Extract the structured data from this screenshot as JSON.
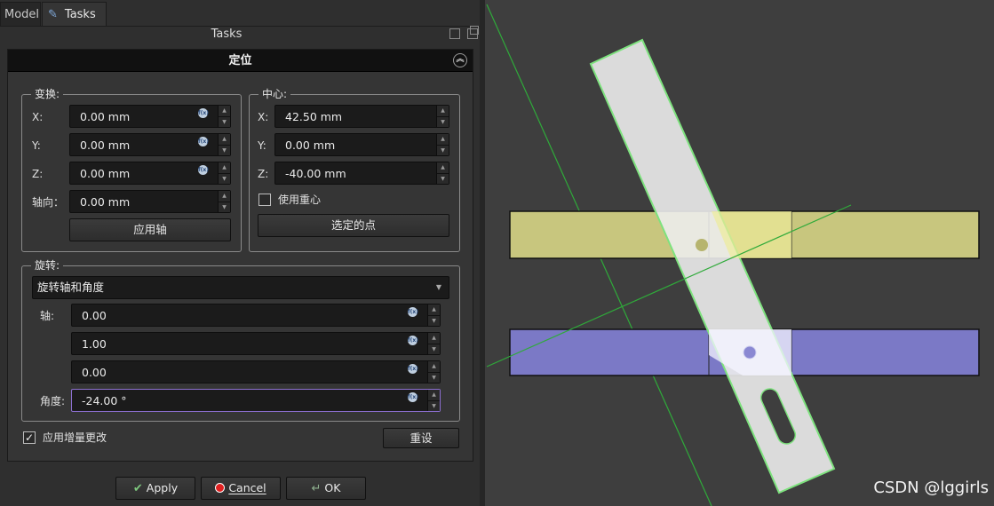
{
  "tabs": [
    {
      "label": "Model"
    },
    {
      "label": "Tasks"
    }
  ],
  "panel_title": "Tasks",
  "dialog": {
    "title": "定位",
    "translation": {
      "title": "变换:",
      "x_label": "X:",
      "x_value": "0.00 mm",
      "y_label": "Y:",
      "y_value": "0.00 mm",
      "z_label": "Z:",
      "z_value": "0.00 mm",
      "axial_label": "轴向：",
      "axial_value": "0.00 mm",
      "apply_axial_button": "应用轴"
    },
    "center": {
      "title": "中心:",
      "x_label": "X:",
      "x_value": "42.50 mm",
      "y_label": "Y:",
      "y_value": "0.00 mm",
      "z_label": "Z:",
      "z_value": "-40.00 mm",
      "use_center_of_mass_label": "使用重心",
      "use_center_of_mass_checked": false,
      "selected_points_button": "选定的点"
    },
    "rotation": {
      "title": "旋转:",
      "mode_selected": "旋转轴和角度",
      "axis_label": "轴:",
      "axis_x": "0.00",
      "axis_y": "1.00",
      "axis_z": "0.00",
      "angle_label": "角度:",
      "angle_value": "-24.00 °"
    },
    "apply_incremental_label": "应用增量更改",
    "apply_incremental_checked": true,
    "reset_button": "重设"
  },
  "buttons": {
    "apply": "Apply",
    "cancel": "Cancel",
    "ok": "OK"
  },
  "view": {
    "watermark": "CSDN @lggirls",
    "colors": {
      "background": "#3e3e3e",
      "yellow_bar": "#c8c67e",
      "blue_bar": "#7b79c6",
      "selected_part": "#ececec",
      "highlight_edge": "#7ee27e",
      "axis_line": "#2faa3a"
    }
  }
}
